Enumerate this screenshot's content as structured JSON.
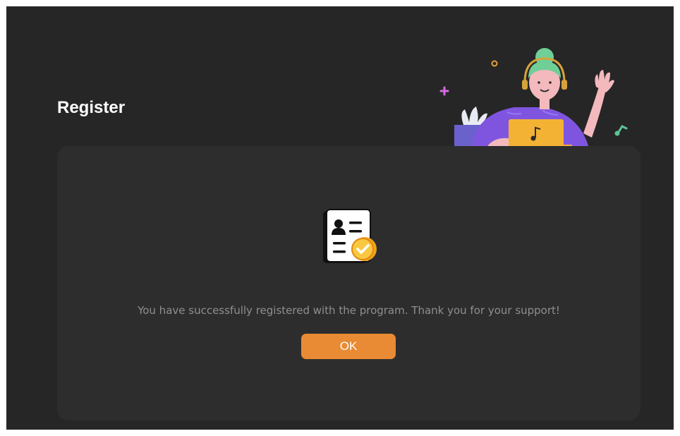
{
  "dialog": {
    "title": "Register",
    "message": "You have successfully registered with the program. Thank you for your support!",
    "ok_label": "OK"
  },
  "icons": {
    "illustration": "woman-with-laptop-waving-illustration",
    "registration": "registration-document-check-icon"
  },
  "colors": {
    "background": "#262626",
    "panel": "#2d2d2d",
    "accent": "#e98a34",
    "title_text": "#ffffff",
    "message_text": "#8f8f8f"
  }
}
